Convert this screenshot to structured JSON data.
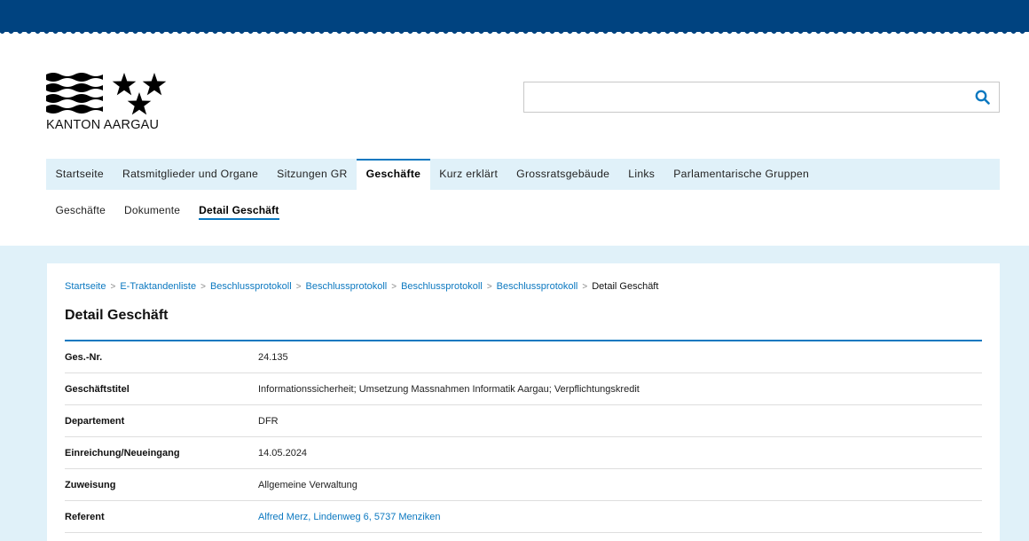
{
  "header": {
    "logo_text": "KANTON AARGAU",
    "search": {
      "placeholder": "",
      "value": ""
    }
  },
  "main_nav": [
    {
      "label": "Startseite",
      "active": false
    },
    {
      "label": "Ratsmitglieder und Organe",
      "active": false
    },
    {
      "label": "Sitzungen GR",
      "active": false
    },
    {
      "label": "Geschäfte",
      "active": true
    },
    {
      "label": "Kurz erklärt",
      "active": false
    },
    {
      "label": "Grossratsgebäude",
      "active": false
    },
    {
      "label": "Links",
      "active": false
    },
    {
      "label": "Parlamentarische Gruppen",
      "active": false
    }
  ],
  "sub_nav": [
    {
      "label": "Geschäfte",
      "active": false
    },
    {
      "label": "Dokumente",
      "active": false
    },
    {
      "label": "Detail Geschäft",
      "active": true
    }
  ],
  "breadcrumb": [
    "Startseite",
    "E-Traktandenliste",
    "Beschlussprotokoll",
    "Beschlussprotokoll",
    "Beschlussprotokoll",
    "Beschlussprotokoll",
    "Detail Geschäft"
  ],
  "page_title": "Detail Geschäft",
  "details": [
    {
      "label": "Ges.-Nr.",
      "value": "24.135"
    },
    {
      "label": "Geschäftstitel",
      "value": "Informationssicherheit; Umsetzung Massnahmen Informatik Aargau; Verpflichtungskredit"
    },
    {
      "label": "Departement",
      "value": "DFR"
    },
    {
      "label": "Einreichung/Neueingang",
      "value": "14.05.2024"
    },
    {
      "label": "Zuweisung",
      "value": "Allgemeine Verwaltung"
    },
    {
      "label": "Referent",
      "value": "Alfred Merz, Lindenweg 6, 5737 Menziken"
    }
  ],
  "colors": {
    "topbar": "#004380",
    "accent": "#0b78c0",
    "panel_bg": "#e0f1f9"
  }
}
